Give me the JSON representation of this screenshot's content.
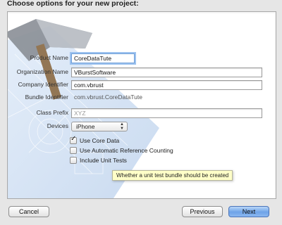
{
  "header": {
    "title": "Choose options for your new project:"
  },
  "form": {
    "product_name": {
      "label": "Product Name",
      "value": "CoreDataTute"
    },
    "organization_name": {
      "label": "Organization Name",
      "value": "VBurstSoftware"
    },
    "company_identifier": {
      "label": "Company Identifier",
      "value": "com.vbrust"
    },
    "bundle_identifier": {
      "label": "Bundle Identifier",
      "value": "com.vbrust.CoreDataTute"
    },
    "class_prefix": {
      "label": "Class Prefix",
      "placeholder": "XYZ"
    },
    "devices": {
      "label": "Devices",
      "selected": "iPhone"
    },
    "options": {
      "use_core_data": {
        "label": "Use Core Data",
        "checked": true
      },
      "use_arc": {
        "label": "Use Automatic Reference Counting",
        "checked": false
      },
      "include_unit_tests": {
        "label": "Include Unit Tests",
        "checked": false
      }
    }
  },
  "tooltip": {
    "text": "Whether a unit test bundle should be created"
  },
  "footer": {
    "cancel_label": "Cancel",
    "previous_label": "Previous",
    "next_label": "Next"
  },
  "colors": {
    "accent": "#6ea3e8",
    "focus_ring": "#9cc2ef",
    "tooltip_bg": "#ffffc8"
  }
}
